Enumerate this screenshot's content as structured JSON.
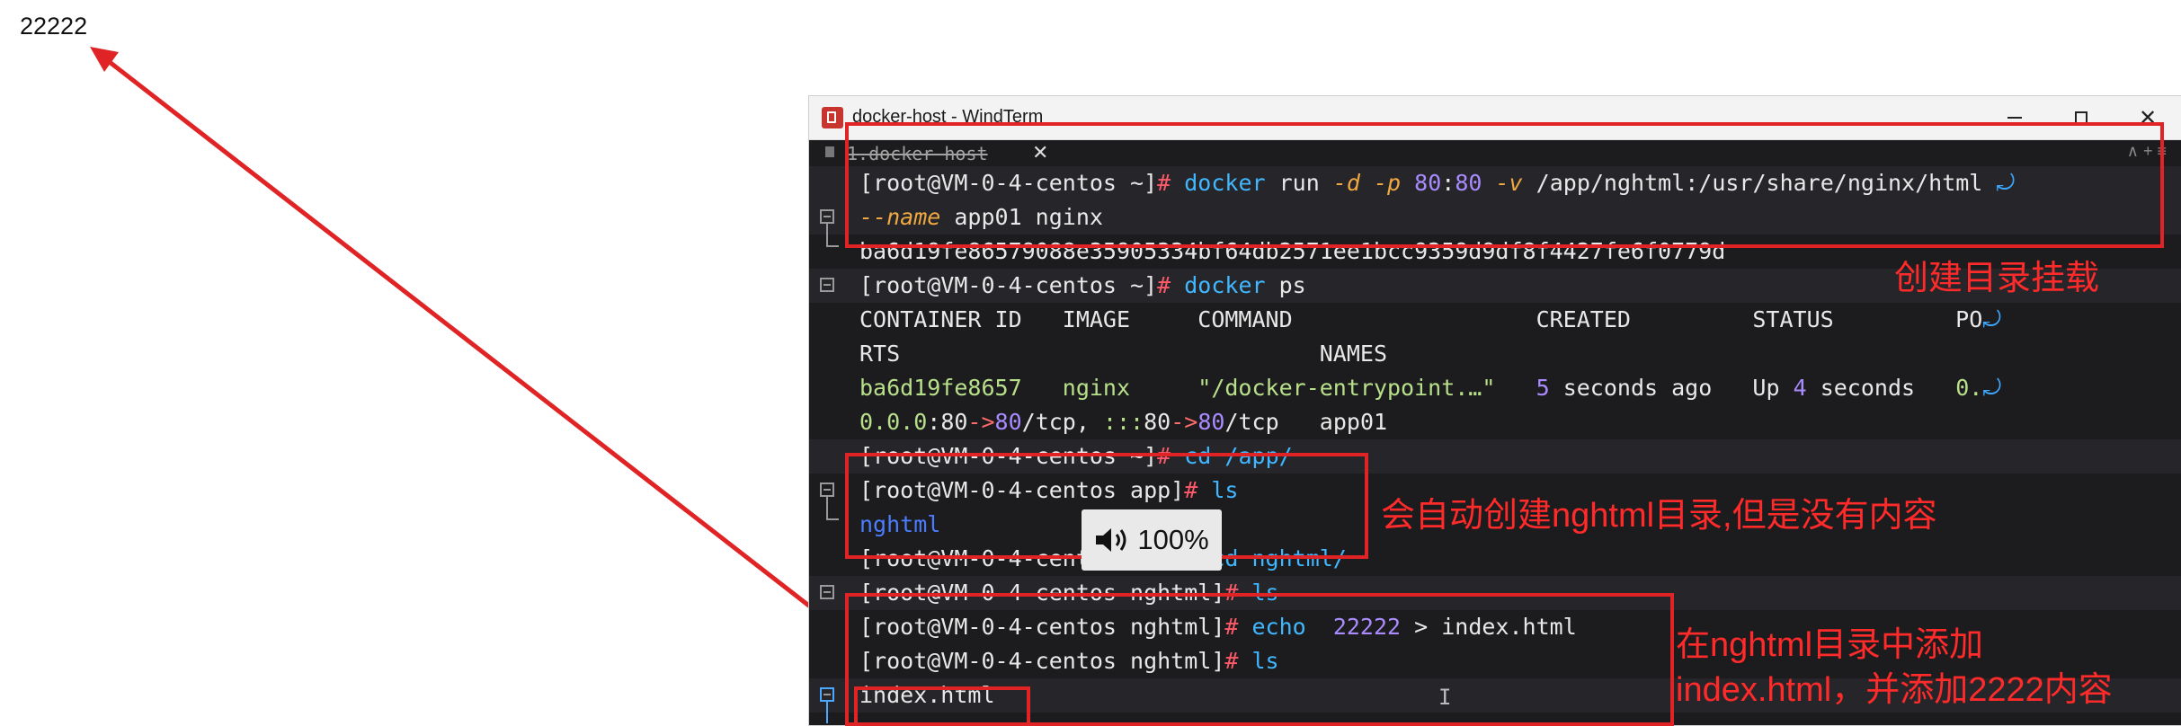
{
  "page": {
    "text": "22222"
  },
  "window": {
    "title": "docker-host - WindTerm",
    "tab_label": "1.docker-host",
    "tab_close": "✕",
    "tab_right": "∧ + ≡"
  },
  "terminal": {
    "l1_prompt": "[root@VM-0-4-centos ~]",
    "l1_hash": "#",
    "l1_cmd": " docker",
    "l1_run": " run ",
    "l1_d": "-d",
    "l1_sp1": " ",
    "l1_p": "-p",
    "l1_port_a": " 80",
    "l1_colon": ":",
    "l1_port_b": "80",
    "l1_sp2": " ",
    "l1_v": "-v",
    "l1_path": " /app/nghtml:/usr/share/nginx/html ",
    "wrap_mark": "⤾",
    "l2_name_opt": "--name",
    "l2_rest": " app01 nginx",
    "l3": "ba6d19fe86579088e35905334bf64db2571ee1bcc9359d9df8f4427fe6f0779d",
    "l4_prompt": "[root@VM-0-4-centos ~]",
    "l4_hash": "#",
    "l4_cmd": " docker",
    "l4_rest": " ps",
    "l5": "CONTAINER ID   IMAGE     COMMAND                  CREATED         STATUS         PO",
    "l6": "RTS                               NAMES",
    "l7_a": "ba6d19fe8657   nginx     \"/docker-entrypoint.…\"   ",
    "l7_5": "5",
    "l7_b": " seconds ago   Up ",
    "l7_4": "4",
    "l7_c": " seconds   ",
    "l7_d": "0.",
    "l8_a": "0.0.0",
    "l8_b": ":80",
    "l8_arrow1": "->",
    "l8_c": "80",
    "l8_d": "/tcp, ",
    "l8_e": ":::",
    "l8_f": "80",
    "l8_arrow2": "->",
    "l8_g": "80",
    "l8_h": "/tcp   app01",
    "l9_prompt": "[root@VM-0-4-centos ~]",
    "l9_hash": "#",
    "l9_cmd": " cd",
    "l9_rest": " /app/",
    "l10_prompt": "[root@VM-0-4-centos app]",
    "l10_hash": "#",
    "l10_rest": " ls",
    "l11": "nghtml",
    "l12_prompt": "[root@VM-0-4-centos app]",
    "l12_hash": "#",
    "l12_cmd": " cd",
    "l12_rest": " nghtml/",
    "l13_prompt": "[root@VM-0-4-centos nghtml]",
    "l13_hash": "#",
    "l13_rest": " ls",
    "l14_prompt": "[root@VM-0-4-centos nghtml]",
    "l14_hash": "#",
    "l14_cmd": " echo",
    "l14_num": "  22222",
    "l14_rest": " > index.html",
    "l15_prompt": "[root@VM-0-4-centos nghtml]",
    "l15_hash": "#",
    "l15_rest": " ls",
    "l16": "index.html",
    "cursor": "I"
  },
  "annotations": {
    "a1": "创建目录挂载",
    "a2": "会自动创建nghtml目录,但是没有内容",
    "a3_line1": "在nghtml目录中添加",
    "a3_line2": "index.html，并添加2222内容"
  },
  "volume": {
    "level": "100%"
  },
  "colors": {
    "annotation": "#e02425",
    "terminal_bg": "#1c1c1e"
  }
}
